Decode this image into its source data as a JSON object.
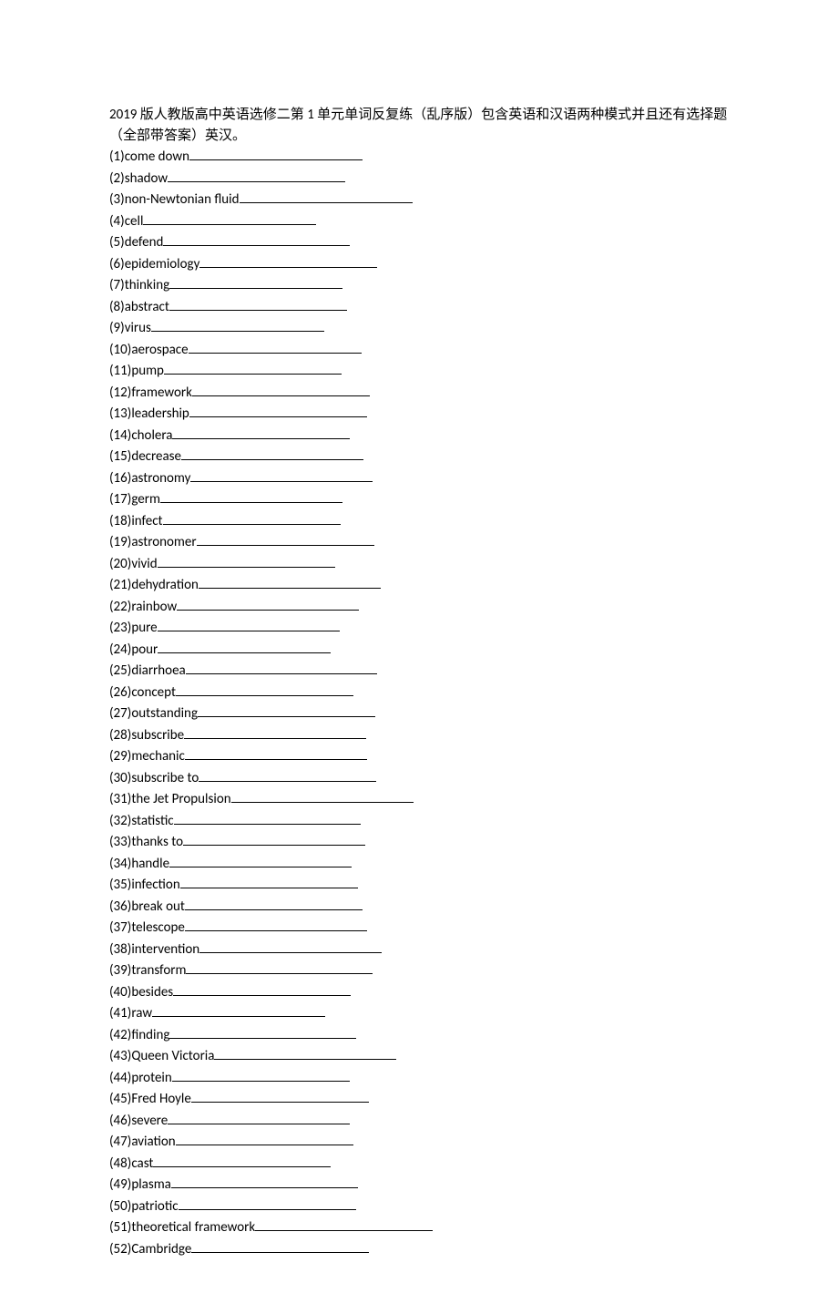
{
  "title": "2019 版人教版高中英语选修二第 1 单元单词反复练（乱序版）包含英语和汉语两种模式并且还有选择题（全部带答案）英汉。",
  "blank_width_default": 190,
  "items": [
    {
      "n": "(1)",
      "w": "come down",
      "bw": 190
    },
    {
      "n": "(2)",
      "w": "shadow",
      "bw": 195
    },
    {
      "n": "(3)",
      "w": "non-Newtonian fluid",
      "bw": 190
    },
    {
      "n": "(4)",
      "w": "cell",
      "bw": 190
    },
    {
      "n": "(5)",
      "w": "defend",
      "bw": 205
    },
    {
      "n": "(6)",
      "w": "epidemiology",
      "bw": 195
    },
    {
      "n": "(7)",
      "w": "thinking",
      "bw": 190
    },
    {
      "n": "(8)",
      "w": "abstract",
      "bw": 195
    },
    {
      "n": "(9)",
      "w": "virus",
      "bw": 190
    },
    {
      "n": "(10)",
      "w": "aerospace",
      "bw": 190
    },
    {
      "n": "(11)",
      "w": "pump",
      "bw": 195
    },
    {
      "n": "(12)",
      "w": "framework",
      "bw": 195
    },
    {
      "n": "(13)",
      "w": "leadership",
      "bw": 195
    },
    {
      "n": "(14)",
      "w": "cholera",
      "bw": 195
    },
    {
      "n": "(15)",
      "w": "decrease",
      "bw": 200
    },
    {
      "n": "(16)",
      "w": "astronomy",
      "bw": 200
    },
    {
      "n": "(17)",
      "w": "germ",
      "bw": 200
    },
    {
      "n": "(18)",
      "w": "infect",
      "bw": 195
    },
    {
      "n": "(19)",
      "w": "astronomer",
      "bw": 195
    },
    {
      "n": "(20)",
      "w": "vivid",
      "bw": 195
    },
    {
      "n": "(21)",
      "w": "dehydration",
      "bw": 200
    },
    {
      "n": "(22)",
      "w": "rainbow",
      "bw": 200
    },
    {
      "n": "(23)",
      "w": "pure",
      "bw": 200
    },
    {
      "n": "(24)",
      "w": "pour",
      "bw": 190
    },
    {
      "n": "(25)",
      "w": "diarrhoea",
      "bw": 210
    },
    {
      "n": "(26)",
      "w": "concept",
      "bw": 195
    },
    {
      "n": "(27)",
      "w": "outstanding",
      "bw": 195
    },
    {
      "n": "(28)",
      "w": "subscribe",
      "bw": 200
    },
    {
      "n": "(29)",
      "w": "mechanic",
      "bw": 200
    },
    {
      "n": "(30)",
      "w": "subscribe to",
      "bw": 195
    },
    {
      "n": "(31)",
      "w": "the Jet Propulsion",
      "bw": 200
    },
    {
      "n": "(32)",
      "w": "statistic",
      "bw": 205
    },
    {
      "n": "(33)",
      "w": "thanks to",
      "bw": 200
    },
    {
      "n": "(34)",
      "w": "handle",
      "bw": 200
    },
    {
      "n": "(35)",
      "w": "infection",
      "bw": 195
    },
    {
      "n": "(36)",
      "w": "break out",
      "bw": 195
    },
    {
      "n": "(37)",
      "w": "telescope",
      "bw": 200
    },
    {
      "n": "(38)",
      "w": "intervention",
      "bw": 200
    },
    {
      "n": "(39)",
      "w": "transform",
      "bw": 205
    },
    {
      "n": "(40)",
      "w": "besides",
      "bw": 195
    },
    {
      "n": "(41)",
      "w": "raw",
      "bw": 190
    },
    {
      "n": "(42)",
      "w": "finding",
      "bw": 205
    },
    {
      "n": "(43)",
      "w": "Queen Victoria",
      "bw": 200
    },
    {
      "n": "(44)",
      "w": "protein",
      "bw": 195
    },
    {
      "n": "(45)",
      "w": "Fred Hoyle",
      "bw": 195
    },
    {
      "n": "(46)",
      "w": "severe",
      "bw": 200
    },
    {
      "n": "(47)",
      "w": "aviation",
      "bw": 195
    },
    {
      "n": "(48)",
      "w": "cast",
      "bw": 195
    },
    {
      "n": "(49)",
      "w": "plasma",
      "bw": 205
    },
    {
      "n": "(50)",
      "w": "patriotic",
      "bw": 195
    },
    {
      "n": "(51)",
      "w": "theoretical framework",
      "bw": 195
    },
    {
      "n": "(52)",
      "w": "Cambridge",
      "bw": 195
    }
  ]
}
